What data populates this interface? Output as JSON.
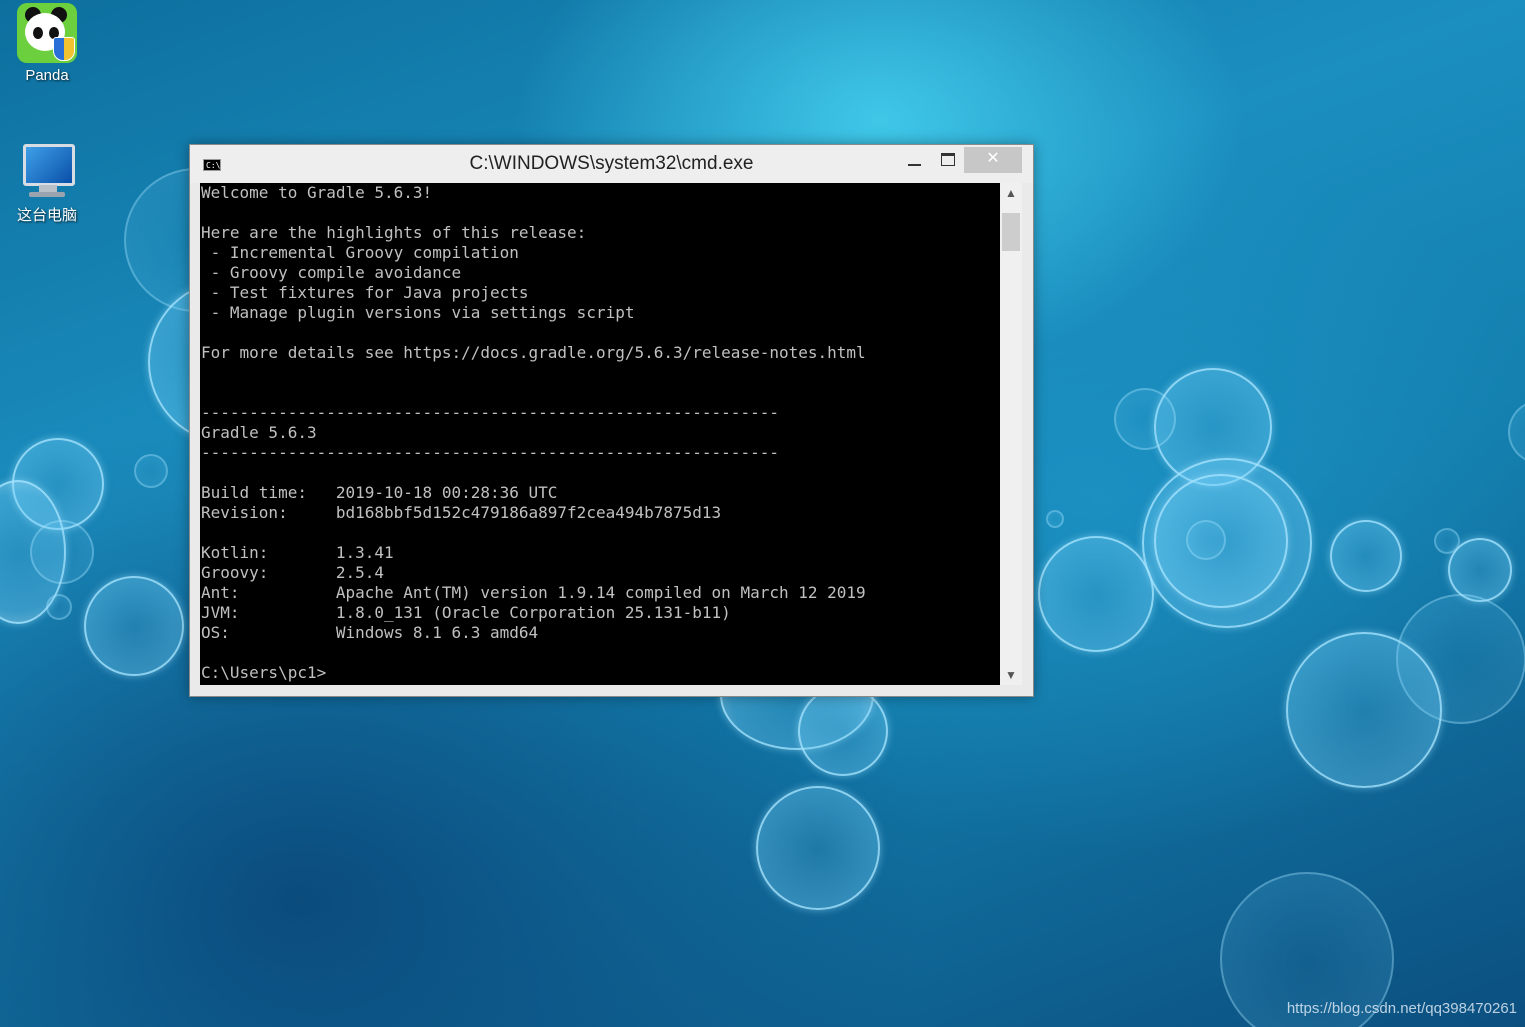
{
  "desktop": {
    "icons": [
      {
        "label": "Panda",
        "icon": "panda-shield-icon"
      },
      {
        "label": "这台电脑",
        "icon": "computer-icon"
      }
    ],
    "watermark": "https://blog.csdn.net/qq398470261"
  },
  "window": {
    "title": "C:\\WINDOWS\\system32\\cmd.exe",
    "icon": "cmd-icon",
    "icon_glyph": "C:\\",
    "close_glyph": "✕",
    "scroll_up_glyph": "▲",
    "scroll_down_glyph": "▼"
  },
  "console": {
    "lines": [
      "Welcome to Gradle 5.6.3!",
      "",
      "Here are the highlights of this release:",
      " - Incremental Groovy compilation",
      " - Groovy compile avoidance",
      " - Test fixtures for Java projects",
      " - Manage plugin versions via settings script",
      "",
      "For more details see https://docs.gradle.org/5.6.3/release-notes.html",
      "",
      "",
      "------------------------------------------------------------",
      "Gradle 5.6.3",
      "------------------------------------------------------------",
      "",
      "Build time:   2019-10-18 00:28:36 UTC",
      "Revision:     bd168bbf5d152c479186a897f2cea494b7875d13",
      "",
      "Kotlin:       1.3.41",
      "Groovy:       2.5.4",
      "Ant:          Apache Ant(TM) version 1.9.14 compiled on March 12 2019",
      "JVM:          1.8.0_131 (Oracle Corporation 25.131-b11)",
      "OS:           Windows 8.1 6.3 amd64",
      "",
      "C:\\Users\\pc1>"
    ]
  },
  "colors": {
    "console_bg": "#000000",
    "console_fg": "#c0c0c0",
    "titlebar_bg": "#eeeeee",
    "close_button": "#c7c7c7"
  }
}
